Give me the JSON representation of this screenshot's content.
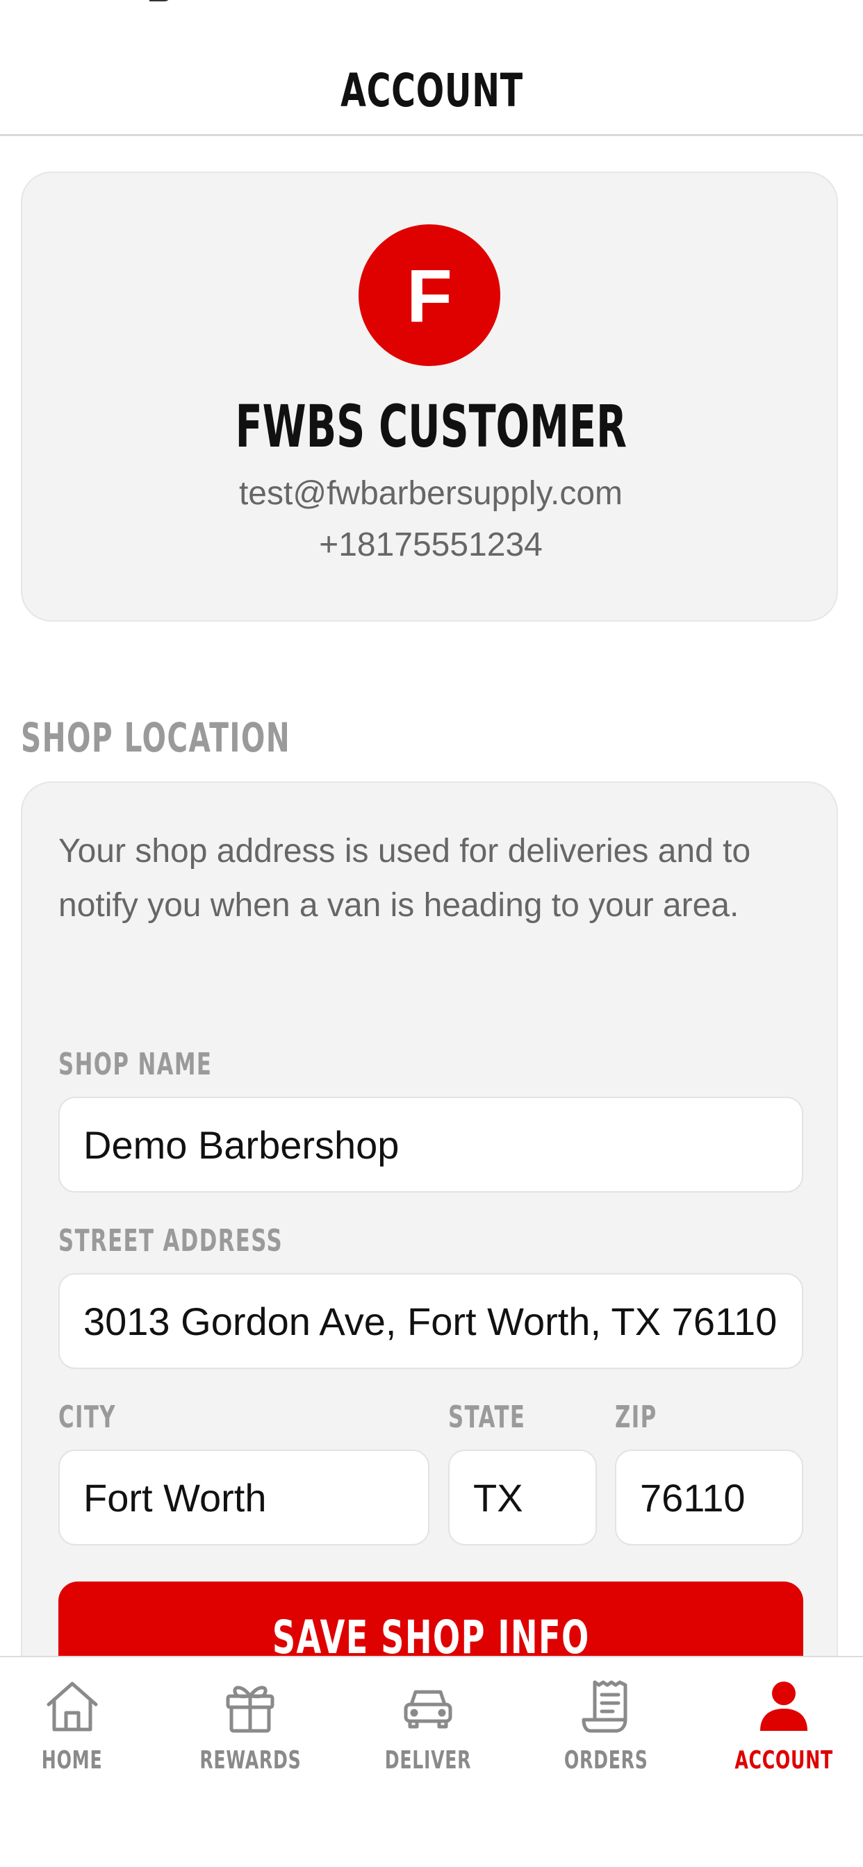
{
  "header": {
    "title": "ACCOUNT"
  },
  "profile": {
    "initial": "F",
    "name": "FWBS CUSTOMER",
    "email": "test@fwbarbersupply.com",
    "phone": "+18175551234"
  },
  "shop_location": {
    "section_title": "SHOP LOCATION",
    "description": "Your shop address is used for deliveries and to notify you when a van is heading to your area.",
    "fields": {
      "shop_name": {
        "label": "SHOP NAME",
        "value": "Demo Barbershop"
      },
      "street_address": {
        "label": "STREET ADDRESS",
        "value": "3013 Gordon Ave, Fort Worth, TX 76110"
      },
      "city": {
        "label": "CITY",
        "value": "Fort Worth"
      },
      "state": {
        "label": "STATE",
        "value": "TX"
      },
      "zip": {
        "label": "ZIP",
        "value": "76110"
      }
    },
    "save_button_label": "SAVE SHOP INFO"
  },
  "tabs": [
    {
      "label": "HOME",
      "icon": "home-icon",
      "active": false
    },
    {
      "label": "REWARDS",
      "icon": "gift-icon",
      "active": false
    },
    {
      "label": "DELIVER",
      "icon": "car-icon",
      "active": false
    },
    {
      "label": "ORDERS",
      "icon": "receipt-icon",
      "active": false
    },
    {
      "label": "ACCOUNT",
      "icon": "person-icon",
      "active": true
    }
  ],
  "colors": {
    "accent": "#df0000",
    "card_background": "#f3f3f3",
    "muted_text": "#9a9a9a",
    "body_text": "#666666"
  }
}
